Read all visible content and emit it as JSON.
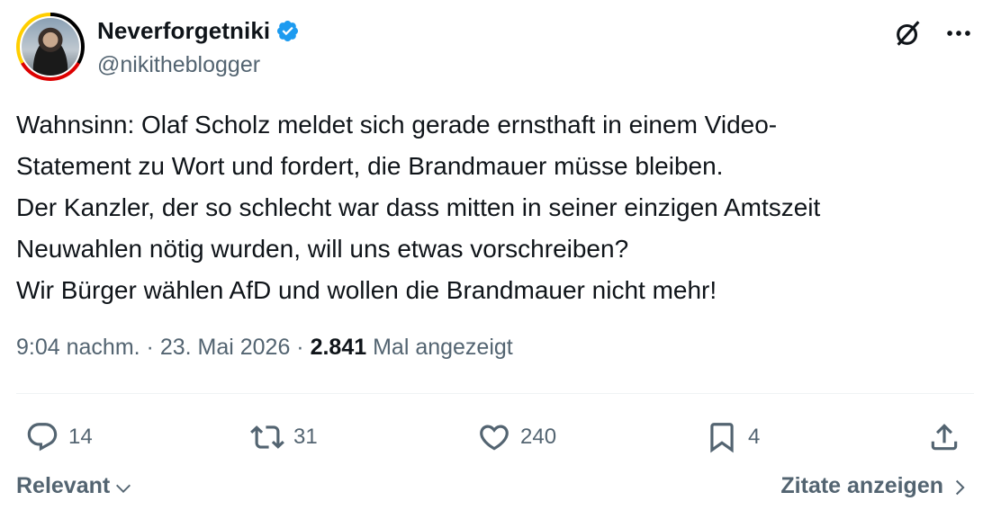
{
  "author": {
    "display_name": "Neverforgetniki",
    "handle": "@nikitheblogger",
    "verified": true
  },
  "tweet": {
    "text": "Wahnsinn: Olaf Scholz meldet sich gerade ernsthaft in einem Video-\nStatement zu Wort und fordert, die Brandmauer müsse bleiben.\nDer Kanzler, der so schlecht war dass mitten in seiner einzigen Amtszeit\nNeuwahlen nötig wurden, will uns etwas vorschreiben?\nWir Bürger wählen AfD und wollen die Brandmauer nicht mehr!",
    "time": "9:04 nachm.",
    "date": "23. Mai 2026",
    "separator": " · ",
    "views_count": "2.841",
    "views_label": " Mal angezeigt"
  },
  "actions": {
    "reply_count": "14",
    "retweet_count": "31",
    "like_count": "240",
    "bookmark_count": "4"
  },
  "footer": {
    "sort_label": "Relevant",
    "quotes_label": "Zitate anzeigen"
  },
  "icons": {
    "verified": "verified-badge-icon",
    "grok": "grok-icon",
    "more": "more-icon",
    "reply": "reply-icon",
    "retweet": "retweet-icon",
    "like": "heart-icon",
    "bookmark": "bookmark-icon",
    "share": "share-icon",
    "chevron_down": "chevron-down-icon",
    "chevron_right": "chevron-right-icon"
  },
  "colors": {
    "text": "#0f1419",
    "secondary": "#536471",
    "verified_blue": "#1d9bf0",
    "divider": "#eff3f4"
  }
}
